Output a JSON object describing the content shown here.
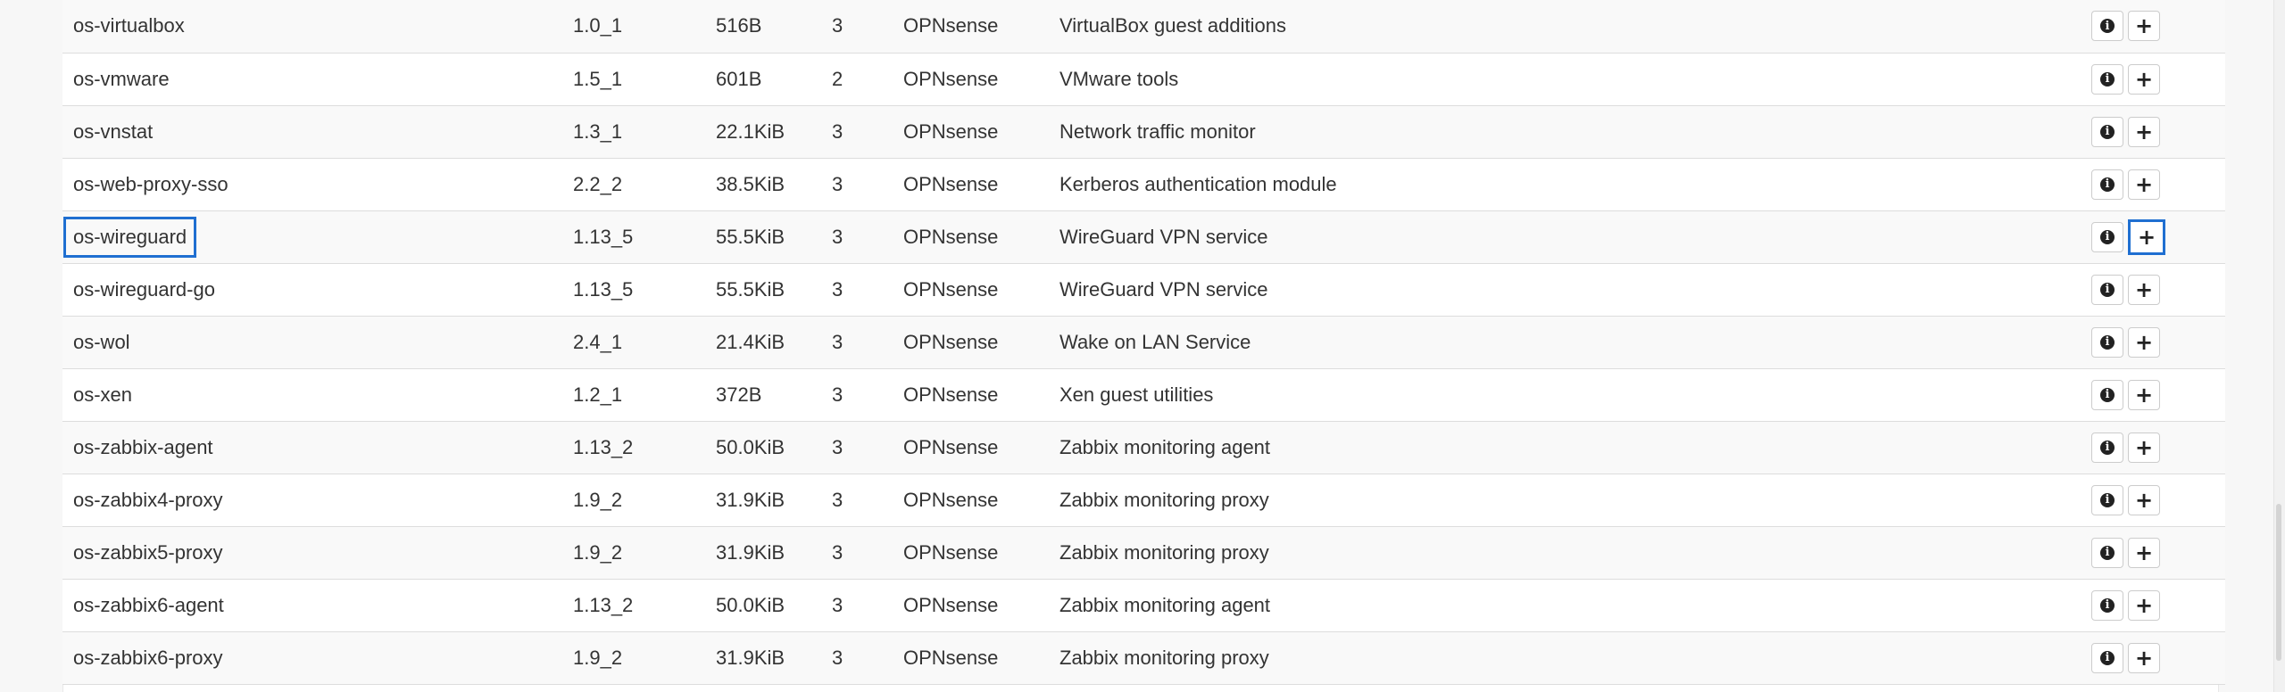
{
  "packages": [
    {
      "name": "os-virtualbox",
      "version": "1.0_1",
      "size": "516B",
      "tier": "3",
      "repository": "OPNsense",
      "description": "VirtualBox guest additions"
    },
    {
      "name": "os-vmware",
      "version": "1.5_1",
      "size": "601B",
      "tier": "2",
      "repository": "OPNsense",
      "description": "VMware tools"
    },
    {
      "name": "os-vnstat",
      "version": "1.3_1",
      "size": "22.1KiB",
      "tier": "3",
      "repository": "OPNsense",
      "description": "Network traffic monitor"
    },
    {
      "name": "os-web-proxy-sso",
      "version": "2.2_2",
      "size": "38.5KiB",
      "tier": "3",
      "repository": "OPNsense",
      "description": "Kerberos authentication module"
    },
    {
      "name": "os-wireguard",
      "version": "1.13_5",
      "size": "55.5KiB",
      "tier": "3",
      "repository": "OPNsense",
      "description": "WireGuard VPN service",
      "highlighted": true
    },
    {
      "name": "os-wireguard-go",
      "version": "1.13_5",
      "size": "55.5KiB",
      "tier": "3",
      "repository": "OPNsense",
      "description": "WireGuard VPN service"
    },
    {
      "name": "os-wol",
      "version": "2.4_1",
      "size": "21.4KiB",
      "tier": "3",
      "repository": "OPNsense",
      "description": "Wake on LAN Service"
    },
    {
      "name": "os-xen",
      "version": "1.2_1",
      "size": "372B",
      "tier": "3",
      "repository": "OPNsense",
      "description": "Xen guest utilities"
    },
    {
      "name": "os-zabbix-agent",
      "version": "1.13_2",
      "size": "50.0KiB",
      "tier": "3",
      "repository": "OPNsense",
      "description": "Zabbix monitoring agent"
    },
    {
      "name": "os-zabbix4-proxy",
      "version": "1.9_2",
      "size": "31.9KiB",
      "tier": "3",
      "repository": "OPNsense",
      "description": "Zabbix monitoring proxy"
    },
    {
      "name": "os-zabbix5-proxy",
      "version": "1.9_2",
      "size": "31.9KiB",
      "tier": "3",
      "repository": "OPNsense",
      "description": "Zabbix monitoring proxy"
    },
    {
      "name": "os-zabbix6-agent",
      "version": "1.13_2",
      "size": "50.0KiB",
      "tier": "3",
      "repository": "OPNsense",
      "description": "Zabbix monitoring agent"
    },
    {
      "name": "os-zabbix6-proxy",
      "version": "1.9_2",
      "size": "31.9KiB",
      "tier": "3",
      "repository": "OPNsense",
      "description": "Zabbix monitoring proxy"
    }
  ],
  "icons": {
    "info": "info-circle-icon",
    "install": "plus-icon"
  },
  "colors": {
    "highlight": "#1f6fd1",
    "row_alt": "#f9f9f9",
    "text": "#333333"
  }
}
